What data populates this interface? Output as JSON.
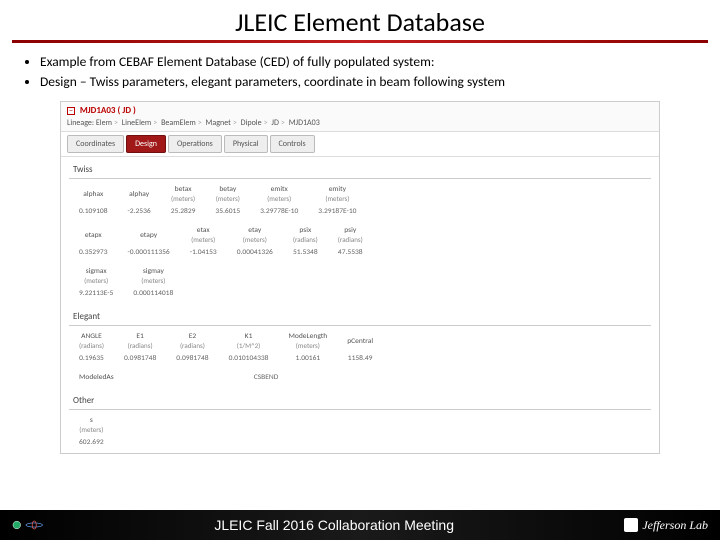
{
  "title": "JLEIC Element Database",
  "bullets": [
    "Example from CEBAF Element Database (CED) of fully populated system:",
    "Design – Twiss parameters, elegant parameters, coordinate in beam following system"
  ],
  "element": {
    "name": "MJD1A03 ( JD )"
  },
  "lineage": {
    "label": "Lineage:",
    "items": [
      "Elem",
      "LineElem",
      "BeamElem",
      "Magnet",
      "Dipole",
      "JD",
      "MJD1A03"
    ]
  },
  "tabs": [
    "Coordinates",
    "Design",
    "Operations",
    "Physical",
    "Controls"
  ],
  "activeTab": "Design",
  "twiss": {
    "title": "Twiss",
    "row1": {
      "headers": [
        "alphax",
        "alphay",
        "betax",
        "betay",
        "emitx",
        "emity"
      ],
      "units": [
        "",
        "",
        "(meters)",
        "(meters)",
        "(meters)",
        "(meters)"
      ],
      "values": [
        "0.109108",
        "-2.2536",
        "25.2829",
        "35.6015",
        "3.29778E-10",
        "3.29187E-10"
      ]
    },
    "row2": {
      "headers": [
        "etapx",
        "etapy",
        "etax",
        "etay",
        "psix",
        "psiy"
      ],
      "units": [
        "",
        "",
        "(meters)",
        "(meters)",
        "(radians)",
        "(radians)"
      ],
      "values": [
        "0.352973",
        "-0.000111356",
        "-1.04153",
        "0.00041326",
        "51.5348",
        "47.5538"
      ]
    },
    "row3": {
      "headers": [
        "sigmax",
        "sigmay"
      ],
      "units": [
        "(meters)",
        "(meters)"
      ],
      "values": [
        "9.22113E-5",
        "0.000114018"
      ]
    }
  },
  "elegant": {
    "title": "Elegant",
    "row1": {
      "headers": [
        "ANGLE",
        "E1",
        "E2",
        "K1",
        "ModeLength",
        "pCentral"
      ],
      "units": [
        "(radians)",
        "(radians)",
        "(radians)",
        "(1/M^2)",
        "(meters)",
        ""
      ],
      "values": [
        "0.19635",
        "0.0981748",
        "0.0981748",
        "0.010104338",
        "1.00161",
        "1158.49"
      ]
    },
    "row2": {
      "headers": [
        "ModeledAs"
      ],
      "values": [
        "CSBEND"
      ]
    }
  },
  "other": {
    "title": "Other",
    "row": {
      "headers": [
        "s"
      ],
      "units": [
        "(meters)"
      ],
      "values": [
        "602.692"
      ]
    }
  },
  "footer": {
    "meeting": "JLEIC Fall 2016 Collaboration Meeting",
    "lab": "Jefferson Lab"
  }
}
